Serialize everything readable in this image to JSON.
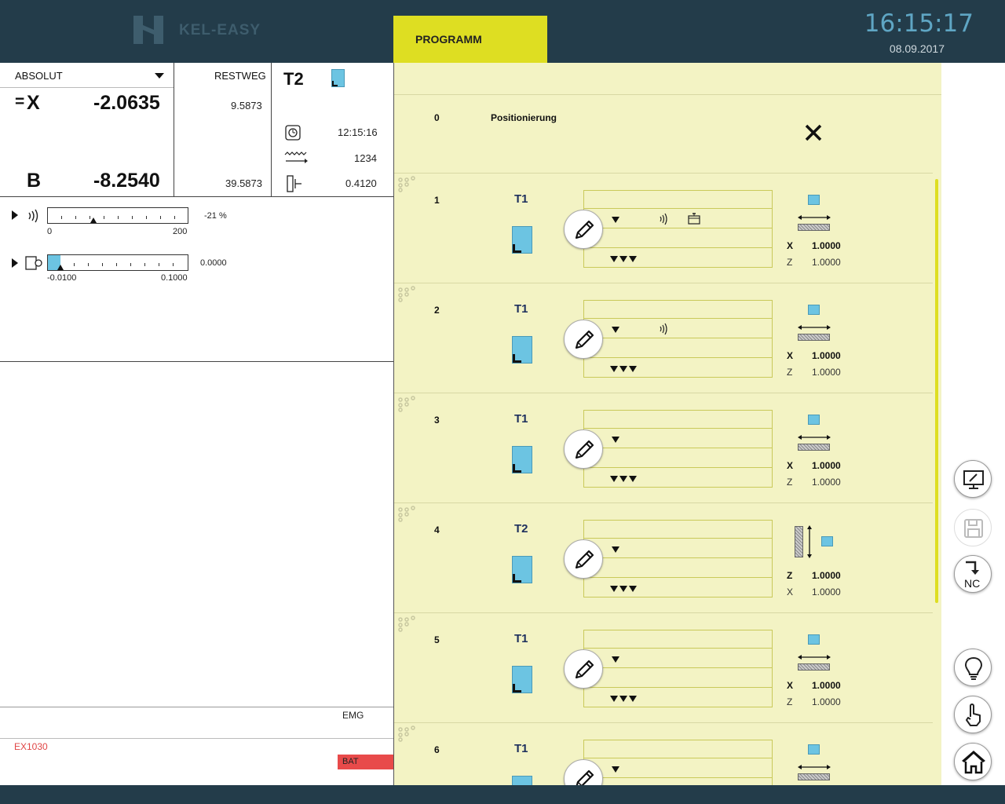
{
  "header": {
    "brand": "KEL-EASY",
    "tab_programm": "PROGRAMM",
    "time": "16:15:17",
    "date": "08.09.2017"
  },
  "position": {
    "mode": "ABSOLUT",
    "restweg_label": "RESTWEG",
    "x_prefix": "=",
    "x_axis": "X",
    "x_value": "-2.0635",
    "x_restweg": "9.5873",
    "b_axis": "B",
    "b_value": "-8.2540",
    "b_restweg": "39.5873"
  },
  "tool_info": {
    "tool": "T2",
    "time": "12:15:16",
    "feed": "1234",
    "value": "0.4120"
  },
  "overrides": {
    "spindle_percent": "-21 %",
    "spindle_min": "0",
    "spindle_max": "200",
    "offset_value": "0.0000",
    "offset_min": "-0.0100",
    "offset_max": "0.1000"
  },
  "status": {
    "emg": "EMG",
    "error_code": "EX1030",
    "bat": "BAT"
  },
  "program": {
    "rows": [
      {
        "num": "0",
        "label": "Positionierung"
      },
      {
        "num": "1",
        "tool": "T1",
        "a1": "X",
        "v1": "1.0000",
        "a2": "Z",
        "v2": "1.0000"
      },
      {
        "num": "2",
        "tool": "T1",
        "a1": "X",
        "v1": "1.0000",
        "a2": "Z",
        "v2": "1.0000"
      },
      {
        "num": "3",
        "tool": "T1",
        "a1": "X",
        "v1": "1.0000",
        "a2": "Z",
        "v2": "1.0000"
      },
      {
        "num": "4",
        "tool": "T2",
        "a1": "Z",
        "v1": "1.0000",
        "a2": "X",
        "v2": "1.0000"
      },
      {
        "num": "5",
        "tool": "T1",
        "a1": "X",
        "v1": "1.0000",
        "a2": "Z",
        "v2": "1.0000"
      },
      {
        "num": "6",
        "tool": "T1"
      }
    ]
  },
  "sidebar": {
    "nc_label": "NC"
  },
  "icons": [
    "logo-icon",
    "spindle-icon",
    "feed-icon",
    "tool-offset-icon",
    "edit-icon",
    "close-icon",
    "monitor-icon",
    "save-icon",
    "nc-transfer-icon",
    "lightbulb-icon",
    "touch-icon",
    "home-icon"
  ],
  "colors": {
    "accent": "#dede22",
    "header": "#233c4a",
    "panel": "#f3f3c4",
    "tool_blue": "#6cc4e2",
    "alert": "#e84a4a",
    "clock": "#5fa6c4"
  }
}
